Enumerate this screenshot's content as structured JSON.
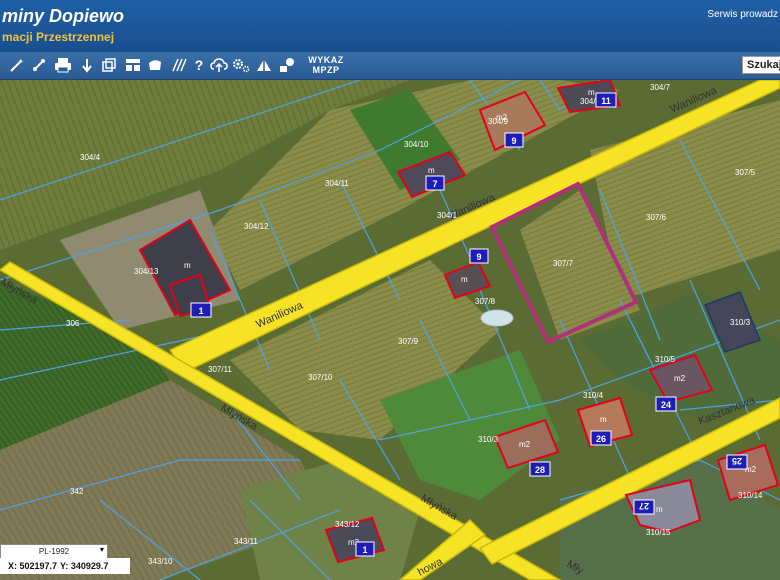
{
  "header": {
    "title": "miny Dopiewo",
    "subtitle": "macji Przestrzennej",
    "service_text": "Serwis prowadz"
  },
  "toolbar": {
    "tools": [
      "pencil-icon",
      "measure-icon",
      "print-icon",
      "pan-icon",
      "layers-icon",
      "layout-icon",
      "shape-icon",
      "hatch-icon",
      "help-icon",
      "upload-icon",
      "settings-icon",
      "terrain-icon",
      "info-icon"
    ],
    "wykaz_label_1": "WYKAZ",
    "wykaz_label_2": "MPZP",
    "search_value": "Szukaj"
  },
  "map": {
    "streets": [
      {
        "name": "Waniliowa",
        "label": "Waniliowa"
      },
      {
        "name": "Waniliowa",
        "label": "Waniliowa"
      },
      {
        "name": "Waniliowa",
        "label": "Waniliowa"
      },
      {
        "name": "Młyńska",
        "label": "Młyńska"
      },
      {
        "name": "Młyńska",
        "label": "Młyńska"
      },
      {
        "name": "Młyńska",
        "label": "Młyńska"
      },
      {
        "name": "Kasztanowa",
        "label": "Kasztanowa"
      },
      {
        "name": "Lipowa",
        "label": "howa"
      },
      {
        "name": "Młyńska",
        "label": "Mły"
      },
      {
        "name": "Młyńska",
        "label": "ińska"
      }
    ],
    "parcels": [
      "304/4",
      "304/13",
      "304/12",
      "304/11",
      "304/10",
      "304/9",
      "307/7",
      "307/6",
      "307/5",
      "307/8",
      "307/9",
      "307/10",
      "307/11",
      "310/3",
      "310/5",
      "310/4",
      "310/3",
      "310/14",
      "310/15",
      "342",
      "343/12",
      "343/11",
      "343/10",
      "306",
      "304/7",
      "304/8",
      "304/1"
    ],
    "house_numbers": [
      "1",
      "7",
      "9",
      "11",
      "9",
      "24",
      "26",
      "28",
      "1",
      "25",
      "27"
    ],
    "building_labels": [
      "m",
      "m",
      "m",
      "m",
      "m",
      "m2",
      "m2",
      "m2",
      "m2",
      "m",
      "m2"
    ],
    "colors": {
      "road_fill": "#f7e325",
      "road_edge": "#c9b80a",
      "selected_parcel": "#b0307a",
      "building_outline": "#e2001a",
      "parcel_line": "#4fa3e8",
      "house_badge": "#1d1db8"
    }
  },
  "footer": {
    "crs": "PL-1992",
    "x_coord": "X: 502197.7",
    "y_coord": "Y: 340929.7"
  }
}
